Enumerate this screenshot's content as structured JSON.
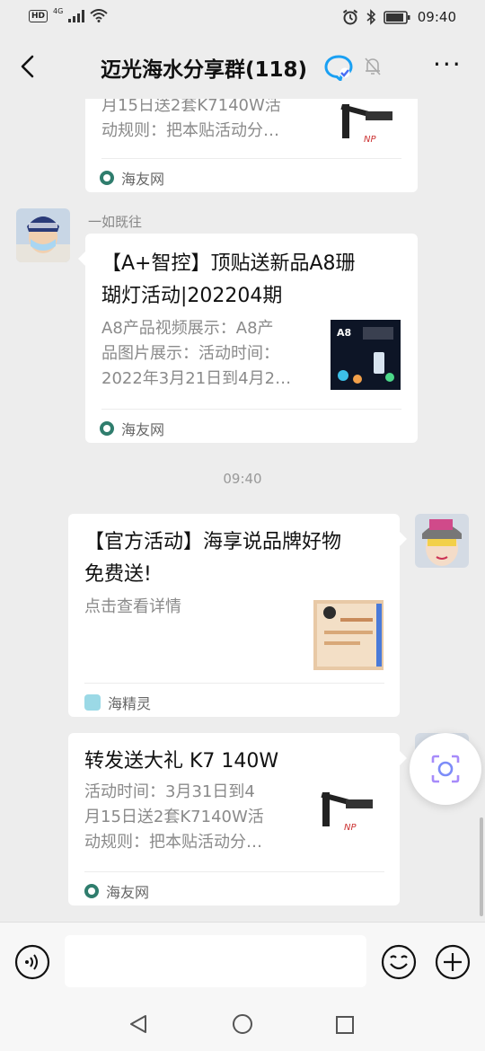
{
  "status_bar": {
    "hd": "HD",
    "network": "4G",
    "time": "09:40"
  },
  "header": {
    "title": "迈光海水分享群(118)"
  },
  "messages": [
    {
      "desc": "月15日送2套K7140W活\n动规则：把本贴活动分…",
      "source": "海友网"
    },
    {
      "sender": "一如既往",
      "title": "【A+智控】顶贴送新品A8珊\n瑚灯活动|202204期",
      "desc": "A8产品视频展示：A8产\n品图片展示：活动时间：\n2022年3月21日到4月2…",
      "thumb_label": "A8",
      "source": "海友网"
    },
    {
      "time": "09:40"
    },
    {
      "title": "【官方活动】海享说品牌好物\n免费送!",
      "desc": "点击查看详情",
      "source": "海精灵"
    },
    {
      "title": "转发送大礼 K7 140W",
      "desc": "活动时间：3月31日到4\n月15日送2套K7140W活\n动规则：把本贴活动分…",
      "source": "海友网"
    }
  ],
  "input": {
    "placeholder": ""
  }
}
